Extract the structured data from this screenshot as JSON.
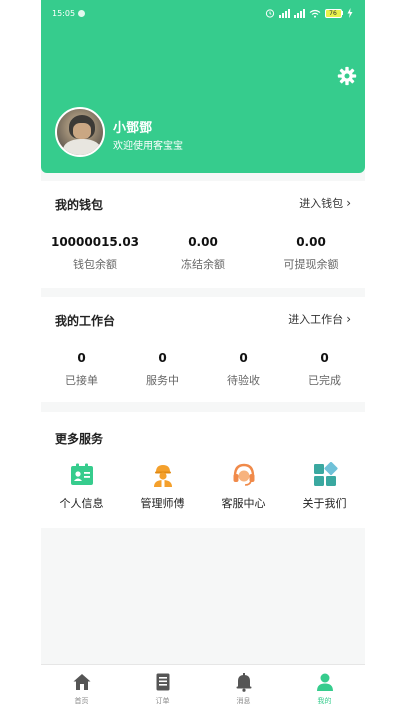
{
  "status_bar": {
    "time": "15:05",
    "battery": "76"
  },
  "profile": {
    "name": "小鄧鄧",
    "subtitle": "欢迎使用客宝宝"
  },
  "wallet": {
    "title": "我的钱包",
    "link": "进入钱包",
    "stats": [
      {
        "value": "10000015.03",
        "label": "钱包余额"
      },
      {
        "value": "0.00",
        "label": "冻结余额"
      },
      {
        "value": "0.00",
        "label": "可提现余额"
      }
    ]
  },
  "workbench": {
    "title": "我的工作台",
    "link": "进入工作台",
    "stats": [
      {
        "value": "0",
        "label": "已接单"
      },
      {
        "value": "0",
        "label": "服务中"
      },
      {
        "value": "0",
        "label": "待验收"
      },
      {
        "value": "0",
        "label": "已完成"
      }
    ]
  },
  "services": {
    "title": "更多服务",
    "items": [
      {
        "label": "个人信息",
        "icon": "id-card-icon"
      },
      {
        "label": "管理师傅",
        "icon": "worker-icon"
      },
      {
        "label": "客服中心",
        "icon": "headset-icon"
      },
      {
        "label": "关于我们",
        "icon": "grid-icon"
      }
    ]
  },
  "tabs": [
    {
      "label": "首页",
      "icon": "home-icon",
      "active": false
    },
    {
      "label": "订单",
      "icon": "order-icon",
      "active": false
    },
    {
      "label": "消息",
      "icon": "bell-icon",
      "active": false
    },
    {
      "label": "我的",
      "icon": "user-icon",
      "active": true
    }
  ],
  "colors": {
    "brand": "#36cc8d",
    "orange": "#f4a02c",
    "teal": "#3aa8a0",
    "tab_inactive": "#555555"
  }
}
